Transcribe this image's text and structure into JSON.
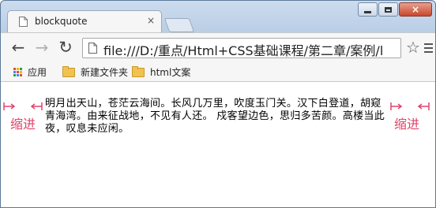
{
  "tab": {
    "title": "blockquote",
    "close_glyph": "×"
  },
  "window_controls": {
    "minimize": "minimize",
    "maximize": "maximize",
    "close": "×"
  },
  "toolbar": {
    "back_glyph": "←",
    "forward_glyph": "→",
    "reload_glyph": "↻",
    "url": "file:///D:/重点/Html+CSS基础课程/第二章/案例/l",
    "star_glyph": "☆"
  },
  "bookmarks": [
    {
      "label": "应用",
      "icon": "apps-grid-icon"
    },
    {
      "label": "新建文件夹",
      "icon": "folder-icon"
    },
    {
      "label": "html文案",
      "icon": "folder-icon"
    }
  ],
  "content": {
    "blockquote_text": "明月出天山，苍茫云海间。长风几万里，吹度玉门关。汉下白登道，胡窥青海湾。由来征战地，不见有人还。 戍客望边色，思归多苦颜。高楼当此夜，叹息未应闲。",
    "left_indent_label": "缩进",
    "right_indent_label": "缩进"
  },
  "colors": {
    "annotation": "#e0446a",
    "chrome": "#c7d7eb"
  }
}
